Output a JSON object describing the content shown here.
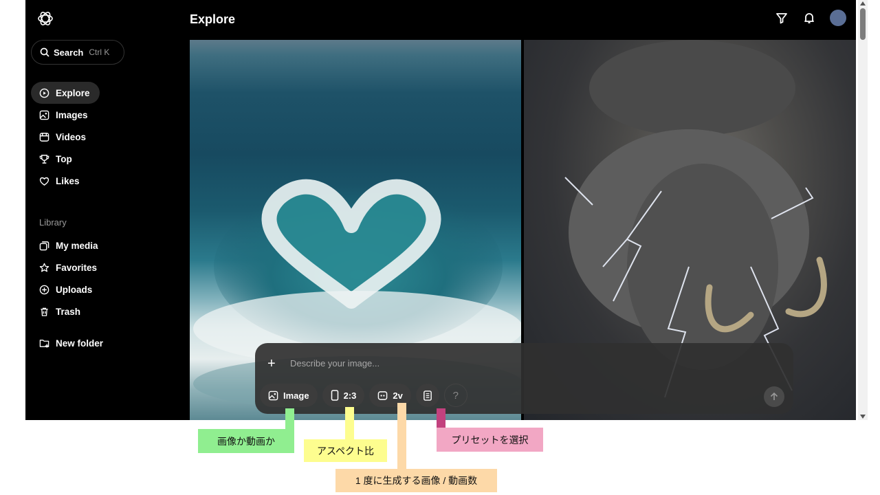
{
  "header": {
    "title": "Explore"
  },
  "sidebar": {
    "search": {
      "label": "Search",
      "shortcut": "Ctrl K"
    },
    "nav": [
      {
        "label": "Explore",
        "icon": "compass-icon",
        "active": true
      },
      {
        "label": "Images",
        "icon": "image-icon"
      },
      {
        "label": "Videos",
        "icon": "video-icon"
      },
      {
        "label": "Top",
        "icon": "trophy-icon"
      },
      {
        "label": "Likes",
        "icon": "heart-icon"
      }
    ],
    "library_label": "Library",
    "library": [
      {
        "label": "My media",
        "icon": "media-icon"
      },
      {
        "label": "Favorites",
        "icon": "star-icon"
      },
      {
        "label": "Uploads",
        "icon": "upload-icon"
      },
      {
        "label": "Trash",
        "icon": "trash-icon"
      }
    ],
    "new_folder": "New folder"
  },
  "prompt": {
    "plus": "+",
    "placeholder": "Describe your image...",
    "chips": {
      "mode": "Image",
      "aspect": "2:3",
      "count": "2v",
      "help": "?"
    }
  },
  "annotations": {
    "mode": "画像か動画か",
    "aspect": "アスペクト比",
    "count": "1 度に生成する画像 / 動画数",
    "preset": "プリセットを選択"
  },
  "colors": {
    "mode": "#90ee90",
    "aspect": "#fdfd8f",
    "count": "#fdd9a8",
    "preset": "#f2a7c4",
    "preset_connector": "#c2417e"
  }
}
